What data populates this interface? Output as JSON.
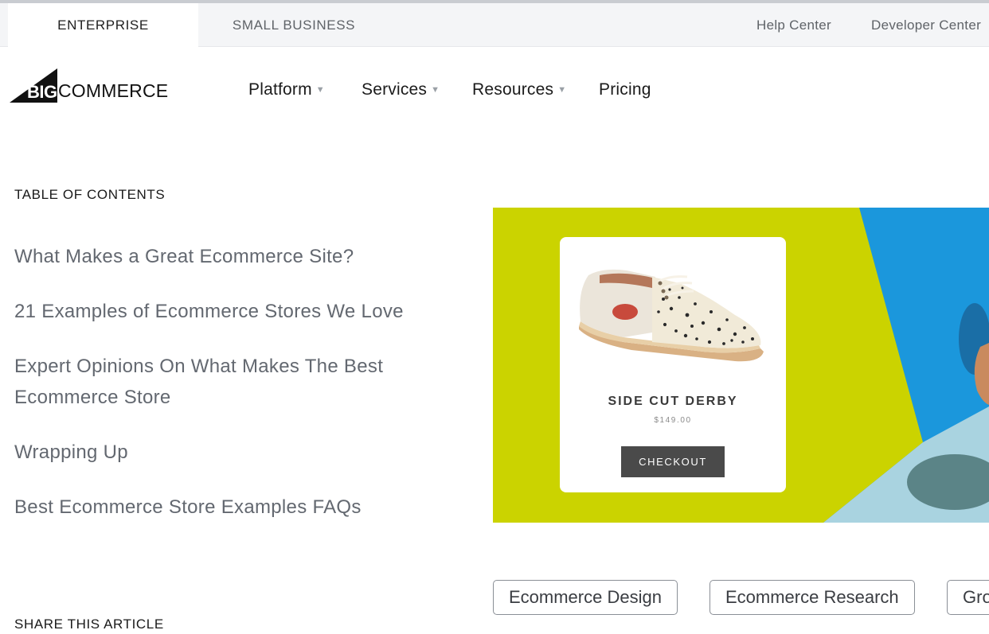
{
  "topbar": {
    "segments": [
      "ENTERPRISE",
      "SMALL BUSINESS"
    ],
    "links": [
      "Help Center",
      "Developer Center"
    ]
  },
  "logo": {
    "big": "BIG",
    "commerce": "COMMERCE"
  },
  "nav": {
    "items": [
      {
        "label": "Platform",
        "has_dropdown": true
      },
      {
        "label": "Services",
        "has_dropdown": true
      },
      {
        "label": "Resources",
        "has_dropdown": true
      },
      {
        "label": "Pricing",
        "has_dropdown": false
      }
    ],
    "caret_icon": "caret-down-icon"
  },
  "toc": {
    "heading": "TABLE OF CONTENTS",
    "items": [
      "What Makes a Great Ecommerce Site?",
      "21 Examples of Ecommerce Stores We Love",
      "Expert Opinions On What Makes The Best Ecommerce Store",
      "Wrapping Up",
      "Best Ecommerce Store Examples FAQs"
    ]
  },
  "share": {
    "heading": "SHARE THIS ARTICLE"
  },
  "hero": {
    "colors": {
      "lime": "#cbd300",
      "blue": "#1b97dc",
      "pale_blue": "#a9d3e0"
    },
    "product": {
      "name": "SIDE CUT DERBY",
      "price": "$149.00",
      "button": "CHECKOUT"
    }
  },
  "tags": [
    "Ecommerce Design",
    "Ecommerce Research",
    "Gro"
  ]
}
